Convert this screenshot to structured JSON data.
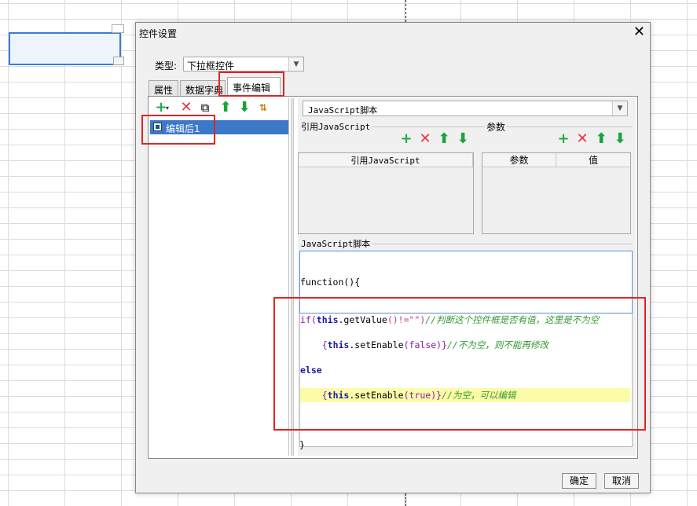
{
  "dialog": {
    "title": "控件设置",
    "type_label": "类型:",
    "type_value": "下拉框控件",
    "tabs": [
      {
        "label": "属性"
      },
      {
        "label": "数据字典"
      },
      {
        "label": "事件编辑"
      }
    ],
    "active_tab": "事件编辑",
    "ok_label": "确定",
    "cancel_label": "取消",
    "close_glyph": "✕"
  },
  "event_list": {
    "items": [
      {
        "label": "编辑后1"
      }
    ]
  },
  "script": {
    "type_value": "JavaScript脚本",
    "ref_js_group": "引用JavaScript",
    "params_group": "参数",
    "ref_js_column": "引用JavaScript",
    "params_columns": [
      "参数",
      "值"
    ],
    "script_group": "JavaScript脚本",
    "code": {
      "line1": "function(){",
      "line2_kw": "if",
      "line2_open": "(",
      "line2_this": "this",
      "line2_call": ".getValue",
      "line2_args": "()!=\"\")",
      "line2_comment": "//判断这个控件框是否有值，这里是不为空",
      "line3_open": "{",
      "line3_this": "this",
      "line3_call": ".setEnable",
      "line3_args": "(false)}",
      "line3_comment": "//不为空，则不能再修改",
      "line4": "else",
      "line5_open": "{",
      "line5_this": "this",
      "line5_call": ".setEnable",
      "line5_args": "(true)}",
      "line5_comment": "//为空，可以编辑",
      "closing": "}"
    }
  },
  "icons": {
    "plus": "plus-icon",
    "delete": "delete-icon",
    "copy": "copy-icon",
    "up": "arrow-up-icon",
    "down": "arrow-down-icon",
    "sort": "sort-icon",
    "dropdown": "chevron-down-icon"
  },
  "colors": {
    "selection": "#3c78c8",
    "annotation": "#e02424",
    "highlight_line": "#fbfba8",
    "comment": "#339933"
  }
}
